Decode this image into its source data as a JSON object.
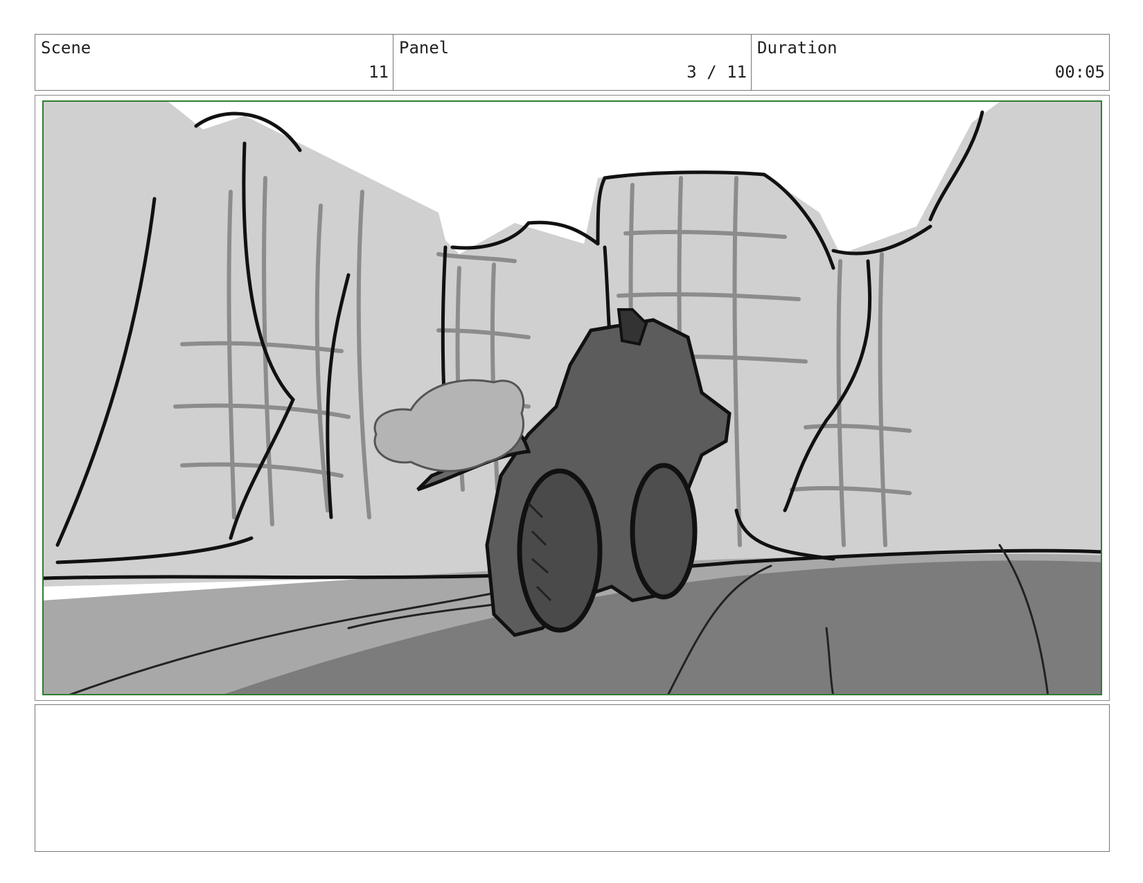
{
  "header": {
    "scene_label": "Scene",
    "scene_value": "11",
    "panel_label": "Panel",
    "panel_value": "3 / 11",
    "duration_label": "Duration",
    "duration_value": "00:05"
  },
  "panel": {
    "frame_color": "#2f7d2f",
    "image_description_icon": "storyboard-sketch-icon"
  },
  "notes": {
    "text": ""
  }
}
